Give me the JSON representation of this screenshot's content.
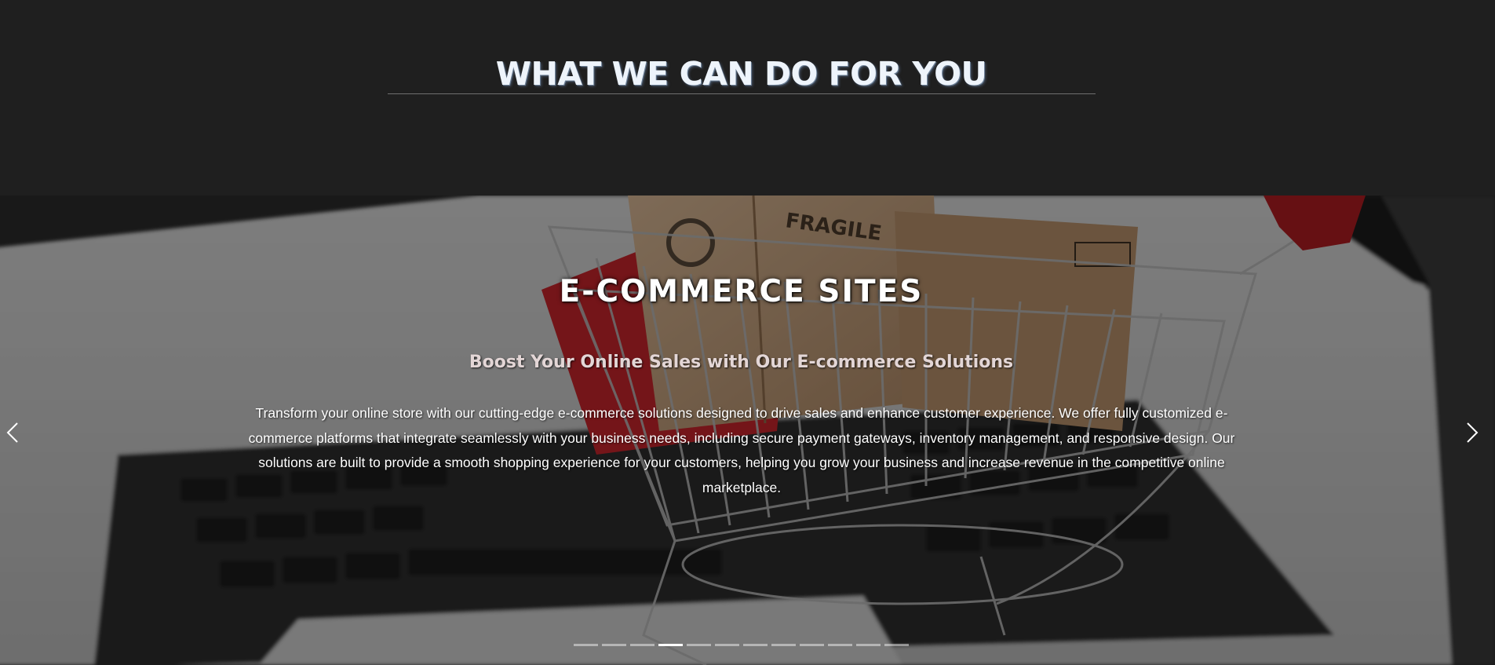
{
  "section": {
    "title": "WHAT WE CAN DO FOR YOU"
  },
  "slider": {
    "active_index": 3,
    "slide": {
      "title": "E-COMMERCE SITES",
      "subtitle": "Boost Your Online Sales with Our E-commerce Solutions",
      "body": "Transform your online store with our cutting-edge e-commerce solutions designed to drive sales and enhance customer experience. We offer fully customized e-commerce platforms that integrate seamlessly with your business needs, including secure payment gateways, inventory management, and responsive design. Our solutions are built to provide a smooth shopping experience for your customers, helping you grow your business and increase revenue in the competitive online marketplace.",
      "background_icon": "shopping-cart-on-laptop-photo",
      "box_label": "FRAGILE"
    },
    "indicator_count": 12,
    "prev_icon": "chevron-left-icon",
    "next_icon": "chevron-right-icon"
  },
  "colors": {
    "page_background": "#1f1f1f",
    "title_text": "#eef4fb",
    "active_indicator": "#ffffff"
  }
}
